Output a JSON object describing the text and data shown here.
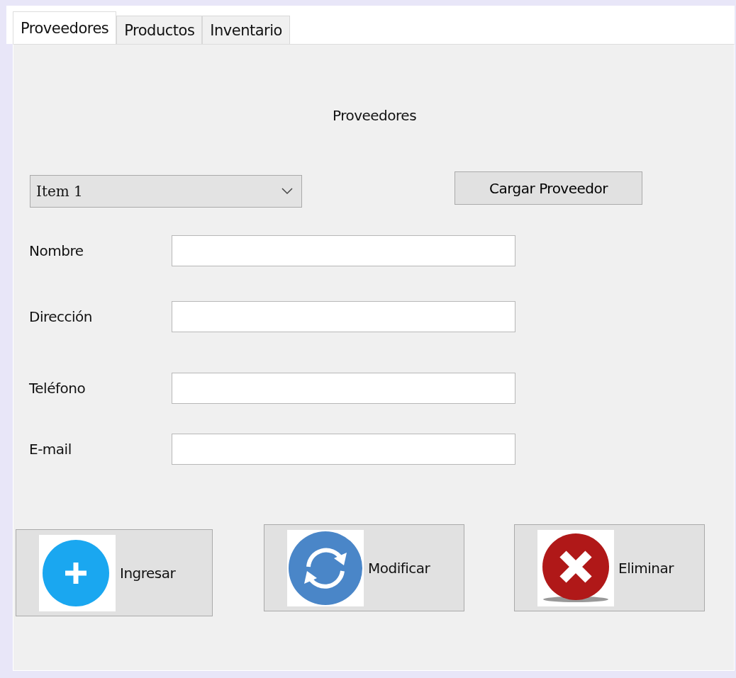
{
  "tabs": [
    {
      "label": "Proveedores",
      "selected": true
    },
    {
      "label": "Productos",
      "selected": false
    },
    {
      "label": "Inventario",
      "selected": false
    }
  ],
  "heading": "Proveedores",
  "provider_select": {
    "value": "Item 1"
  },
  "load_button": "Cargar Proveedor",
  "fields": [
    {
      "label": "Nombre"
    },
    {
      "label": "Dirección"
    },
    {
      "label": "Teléfono"
    },
    {
      "label": "E-mail"
    }
  ],
  "actions": [
    {
      "label": "Ingresar",
      "kind": "add"
    },
    {
      "label": "Modificar",
      "kind": "refresh"
    },
    {
      "label": "Eliminar",
      "kind": "delete"
    }
  ]
}
